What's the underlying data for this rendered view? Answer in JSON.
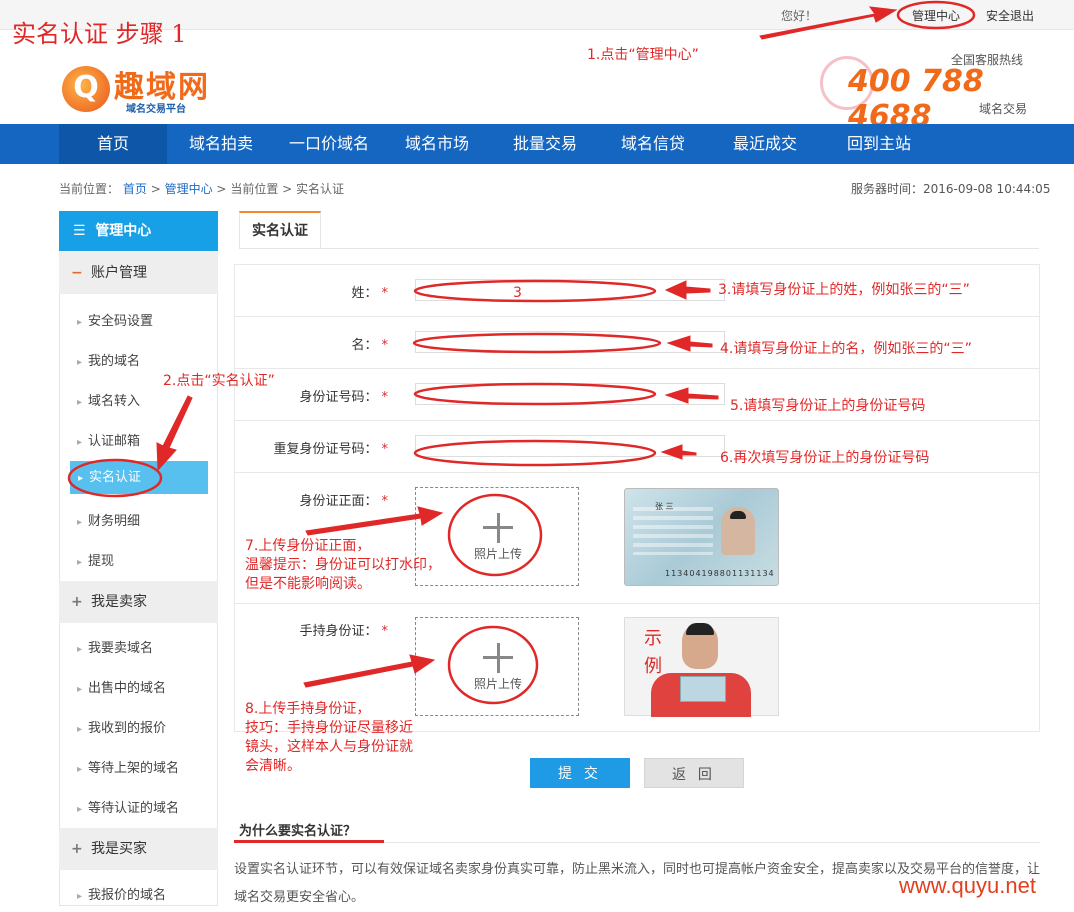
{
  "step_title": "实名认证 步骤 1",
  "topbar": {
    "greeting": "您好！",
    "manage_center": "管理中心",
    "logout": "安全退出"
  },
  "header": {
    "logo_glyph": "Q",
    "logo_text": "趣域网",
    "logo_sub": "域名交易平台",
    "hotline_label": "全国客服热线",
    "hotline_number": "400 788 4688",
    "hotline_sub": "域名交易"
  },
  "nav": {
    "items": [
      "首页",
      "域名拍卖",
      "一口价域名",
      "域名市场",
      "批量交易",
      "域名信贷",
      "最近成交",
      "回到主站"
    ]
  },
  "breadcrumb": {
    "prefix": "当前位置：",
    "home": "首页",
    "sep": ">",
    "manage": "管理中心",
    "current_label": "当前位置",
    "current": "实名认证"
  },
  "server_time": "服务器时间：2016-09-08 10:44:05",
  "sidebar": {
    "title": "管理中心",
    "groups": [
      {
        "label": "账户管理",
        "items": [
          "安全码设置",
          "我的域名",
          "域名转入",
          "认证邮箱",
          "实名认证",
          "财务明细",
          "提现"
        ]
      },
      {
        "label": "我是卖家",
        "items": [
          "我要卖域名",
          "出售中的域名",
          "我收到的报价",
          "等待上架的域名",
          "等待认证的域名"
        ]
      },
      {
        "label": "我是买家",
        "items": [
          "我报价的域名"
        ]
      }
    ]
  },
  "tab": "实名认证",
  "form": {
    "surname": "姓：",
    "given_name": "名：",
    "id_number": "身份证号码：",
    "id_number_repeat": "重复身份证号码：",
    "id_front": "身份证正面：",
    "id_hold": "手持身份证：",
    "required_mark": "*",
    "upload_text": "照片上传",
    "surname_value": "3"
  },
  "samples": {
    "id_name": "张 三",
    "id_number": "113404198801131134",
    "example_1": "示",
    "example_2": "例"
  },
  "buttons": {
    "submit": "提 交",
    "back": "返 回"
  },
  "why": {
    "title": "为什么要实名认证？",
    "text": "设置实名认证环节，可以有效保证域名卖家身份真实可靠，防止黑米流入，同时也可提高帐户资金安全，提高卖家以及交易平台的信誉度，让域名交易更安全省心。"
  },
  "annotations": {
    "a1": "1.点击“管理中心”",
    "a2": "2.点击“实名认证”",
    "a3": "3.请填写身份证上的姓，例如张三的“三”",
    "a4": "4.请填写身份证上的名，例如张三的“三”",
    "a5": "5.请填写身份证上的身份证号码",
    "a6": "6.再次填写身份证上的身份证号码",
    "a7_1": "7.上传身份证正面，",
    "a7_2": "温馨提示：身份证可以打水印，",
    "a7_3": "但是不能影响阅读。",
    "a8_1": "8.上传手持身份证，",
    "a8_2": "技巧：手持身份证尽量移近",
    "a8_3": "镜头，这样本人与身份证就",
    "a8_4": "会清晰。"
  },
  "watermark": "www.quyu.net",
  "colors": {
    "nav_blue": "#1566c0",
    "sidebar_blue": "#17a0e6",
    "annotation_red": "#e02828",
    "brand_orange": "#f06a1a"
  }
}
